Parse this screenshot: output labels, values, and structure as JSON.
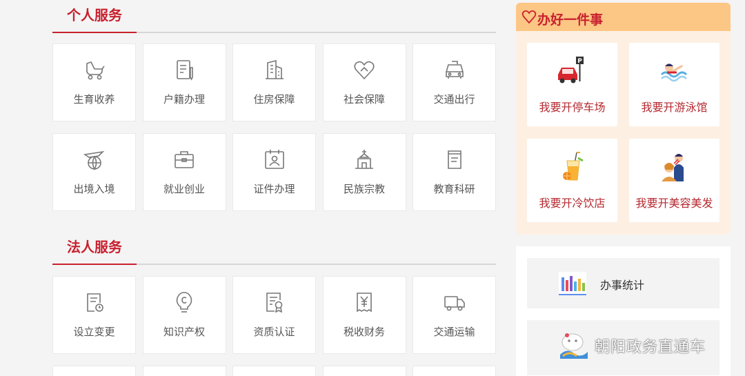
{
  "personal": {
    "title": "个人服务",
    "items": [
      {
        "label": "生育收养",
        "icon": "stroller-icon"
      },
      {
        "label": "户籍办理",
        "icon": "document-pen-icon"
      },
      {
        "label": "住房保障",
        "icon": "building-icon"
      },
      {
        "label": "社会保障",
        "icon": "heart-hand-icon"
      },
      {
        "label": "交通出行",
        "icon": "car-icon"
      },
      {
        "label": "出境入境",
        "icon": "plane-globe-icon"
      },
      {
        "label": "就业创业",
        "icon": "briefcase-icon"
      },
      {
        "label": "证件办理",
        "icon": "id-card-icon"
      },
      {
        "label": "民族宗教",
        "icon": "temple-icon"
      },
      {
        "label": "教育科研",
        "icon": "book-icon"
      }
    ]
  },
  "legal": {
    "title": "法人服务",
    "items": [
      {
        "label": "设立变更",
        "icon": "doc-refresh-icon"
      },
      {
        "label": "知识产权",
        "icon": "copyright-bulb-icon"
      },
      {
        "label": "资质认证",
        "icon": "certificate-icon"
      },
      {
        "label": "税收财务",
        "icon": "yen-receipt-icon"
      },
      {
        "label": "交通运输",
        "icon": "truck-icon"
      }
    ]
  },
  "one_thing": {
    "title": "办好一件事",
    "items": [
      {
        "label": "我要开停车场",
        "icon": "parking-car-icon"
      },
      {
        "label": "我要开游泳馆",
        "icon": "swimmer-icon"
      },
      {
        "label": "我要开冷饮店",
        "icon": "cold-drink-icon"
      },
      {
        "label": "我要开美容美发",
        "icon": "hairdresser-icon"
      }
    ]
  },
  "stats": {
    "label": "办事统计",
    "icon": "bar-chart-icon"
  },
  "watermark": {
    "text": "朝阳政务直通车"
  },
  "colors": {
    "accent": "#c8202e",
    "panel_header": "#fcc685",
    "panel_bg": "#fdf0e3"
  }
}
